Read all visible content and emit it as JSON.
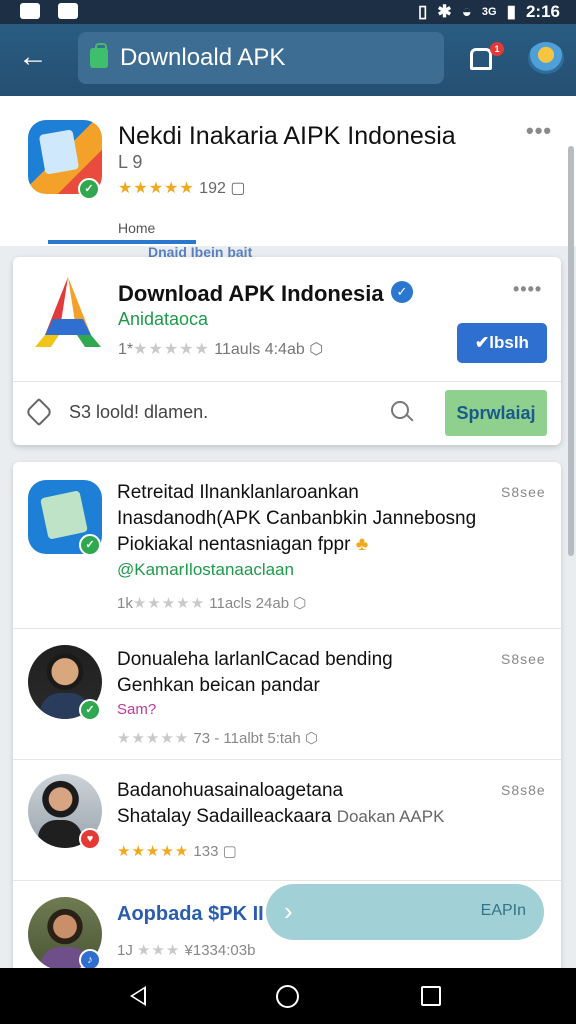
{
  "status_bar": {
    "time": "2:16",
    "network": "3G"
  },
  "app_bar": {
    "search_text": "Downloald APK",
    "notification_count": "1"
  },
  "top_app": {
    "title": "Nekdi Inakaria AIPK Indonesia",
    "subtitle": "L 9",
    "stars": "★★★★★",
    "rating_count": "192",
    "tab_label": "Home",
    "faded_text": "Dnaid Ibein bait"
  },
  "featured": {
    "title": "Download APK Indonesia",
    "developer": "Anidataoca",
    "meta": "11auls 4:4ab",
    "stars": "★★★★★",
    "stars_prefix": "1*",
    "install_label": "✔lbslh",
    "search_text": "S3 loold! dlamen.",
    "search_button": "Sprwlaiaj"
  },
  "list": [
    {
      "line1": "Retreitad Ilnanklanlaroankan",
      "line2": "Inasdanodh(APK Canbanbkin Jannebosng",
      "line3": "Piokiakal nentasniagan fppr",
      "line4": "@KamarIlostanaaclaan",
      "stars_prefix": "1k",
      "stars": "★★★★★",
      "meta": "11acls 24ab",
      "more": "S8see"
    },
    {
      "line1": "Donualeha larlanlCacad bending",
      "line2": "Genhkan beican pandar",
      "line3": "Sam?",
      "stars_prefix": "",
      "stars": "★★★★★",
      "meta": "73 - 11albt 5:tah",
      "more": "S8see"
    },
    {
      "line1": "Badanohuasainaloagetana",
      "line2": "Shatalay Sadailleackaara",
      "line2b": "Doakan AAPK",
      "stars": "★★★★★",
      "meta": "133",
      "more": "S8s8e"
    },
    {
      "line1": "Aopbada $PK II",
      "stars_prefix": "1J",
      "stars": "★★★",
      "meta": "¥1334:03b"
    }
  ],
  "floating_banner": {
    "label": "EAPIn"
  },
  "colors": {
    "appbar": "#2a5c82",
    "accent": "#2f6fd0",
    "green": "#1e9a4a",
    "star": "#f2a81d"
  }
}
